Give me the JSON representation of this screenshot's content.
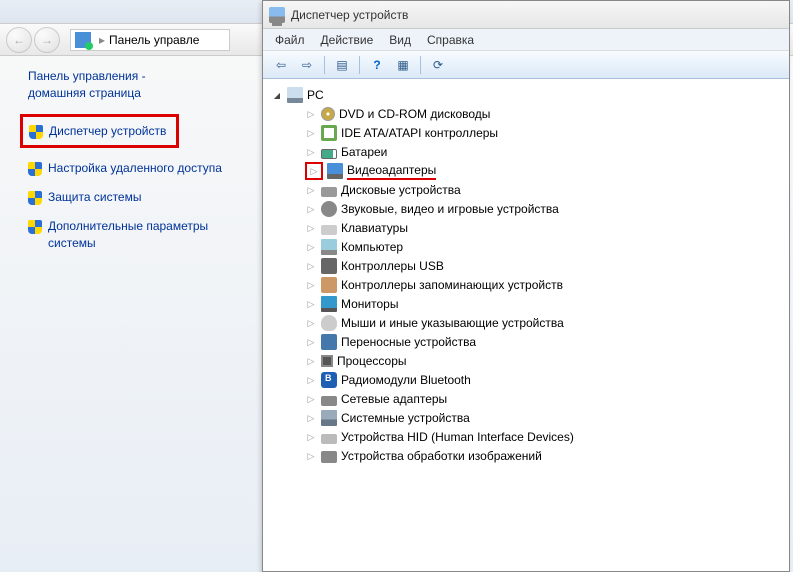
{
  "cp": {
    "breadcrumb_label": "Панель управле",
    "sidebar_title_l1": "Панель управления -",
    "sidebar_title_l2": "домашняя страница",
    "items": [
      {
        "label": "Диспетчер устройств",
        "highlighted": true
      },
      {
        "label": "Настройка удаленного доступа"
      },
      {
        "label": "Защита системы"
      },
      {
        "label": "Дополнительные параметры системы"
      }
    ]
  },
  "dm": {
    "title": "Диспетчер устройств",
    "menu": {
      "file": "Файл",
      "action": "Действие",
      "view": "Вид",
      "help": "Справка"
    },
    "root": {
      "label": "PC"
    },
    "devices": [
      {
        "label": "DVD и CD-ROM дисководы",
        "icon": "ico-disc"
      },
      {
        "label": "IDE ATA/ATAPI контроллеры",
        "icon": "ico-ide"
      },
      {
        "label": "Батареи",
        "icon": "ico-battery"
      },
      {
        "label": "Видеоадаптеры",
        "icon": "ico-video",
        "highlighted": true
      },
      {
        "label": "Дисковые устройства",
        "icon": "ico-disk"
      },
      {
        "label": "Звуковые, видео и игровые устройства",
        "icon": "ico-sound"
      },
      {
        "label": "Клавиатуры",
        "icon": "ico-input"
      },
      {
        "label": "Компьютер",
        "icon": "ico-comp"
      },
      {
        "label": "Контроллеры USB",
        "icon": "ico-usb"
      },
      {
        "label": "Контроллеры запоминающих устройств",
        "icon": "ico-storage"
      },
      {
        "label": "Мониторы",
        "icon": "ico-monitor"
      },
      {
        "label": "Мыши и иные указывающие устройства",
        "icon": "ico-mouse"
      },
      {
        "label": "Переносные устройства",
        "icon": "ico-portable"
      },
      {
        "label": "Процессоры",
        "icon": "ico-cpu"
      },
      {
        "label": "Радиомодули Bluetooth",
        "icon": "ico-bt"
      },
      {
        "label": "Сетевые адаптеры",
        "icon": "ico-net"
      },
      {
        "label": "Системные устройства",
        "icon": "ico-sys"
      },
      {
        "label": "Устройства HID (Human Interface Devices)",
        "icon": "ico-hid"
      },
      {
        "label": "Устройства обработки изображений",
        "icon": "ico-image"
      }
    ]
  }
}
